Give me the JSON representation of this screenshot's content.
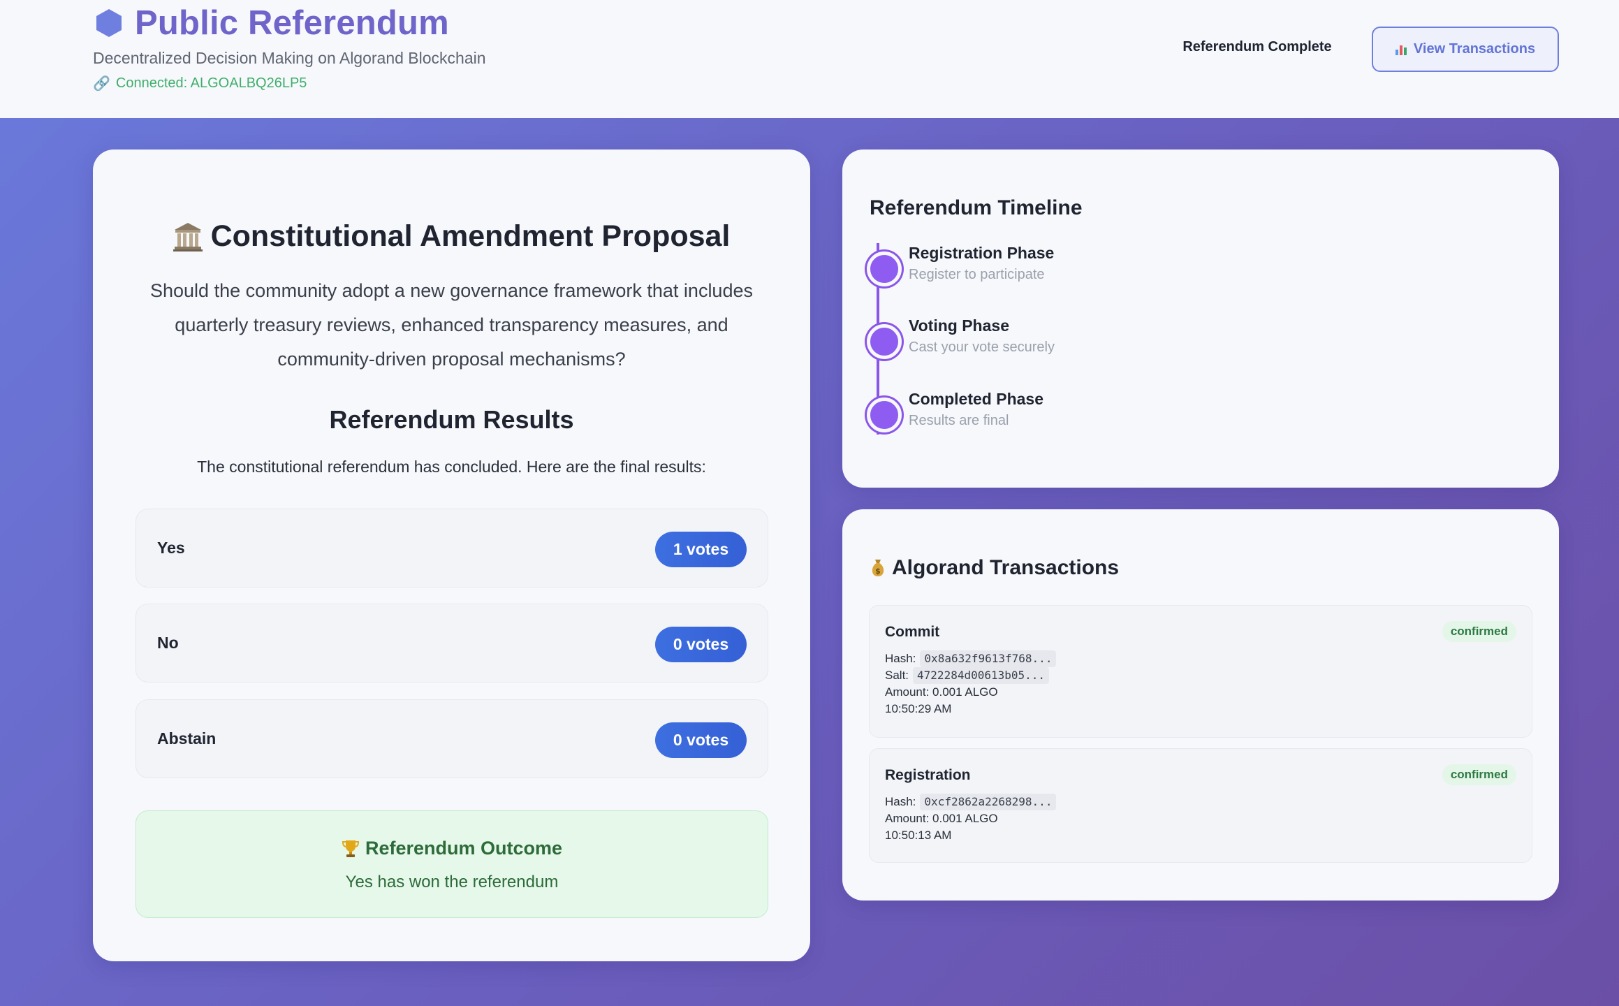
{
  "header": {
    "title": "Public Referendum",
    "subtitle": "Decentralized Decision Making on Algorand Blockchain",
    "connected_label": "Connected: ALGOALBQ26LP5",
    "status": "Referendum Complete",
    "view_transactions_label": "View Transactions",
    "icons": {
      "brand": "hexagon-icon",
      "connection": "link-icon",
      "button": "bar-chart-icon"
    },
    "colors": {
      "brand": "#6f64c9",
      "connected": "#3fae6a",
      "button_border": "#6f7fdc"
    }
  },
  "proposal": {
    "title": "Constitutional Amendment Proposal",
    "icon": "classical-building-icon",
    "description": "Should the community adopt a new governance framework that includes quarterly treasury reviews, enhanced transparency measures, and community-driven proposal mechanisms?"
  },
  "results": {
    "title": "Referendum Results",
    "description": "The constitutional referendum has concluded. Here are the final results:",
    "options": [
      {
        "label": "Yes",
        "votes_label": "1 votes"
      },
      {
        "label": "No",
        "votes_label": "0 votes"
      },
      {
        "label": "Abstain",
        "votes_label": "0 votes"
      }
    ],
    "outcome": {
      "title": "Referendum Outcome",
      "icon": "trophy-icon",
      "text": "Yes has won the referendum"
    },
    "colors": {
      "vote_pill": "#3d6fe0",
      "outcome_text": "#2d6b3a"
    }
  },
  "timeline": {
    "title": "Referendum Timeline",
    "steps": [
      {
        "name": "Registration Phase",
        "description": "Register to participate"
      },
      {
        "name": "Voting Phase",
        "description": "Cast your vote securely"
      },
      {
        "name": "Completed Phase",
        "description": "Results are final"
      }
    ],
    "colors": {
      "accent": "#8a56e8"
    }
  },
  "transactions": {
    "title": "Algorand Transactions",
    "icon": "money-bag-icon",
    "items": [
      {
        "type": "Commit",
        "status": "confirmed",
        "hash_label": "Hash:",
        "hash": "0x8a632f9613f768...",
        "salt_label": "Salt:",
        "salt": "4722284d00613b05...",
        "amount": "Amount: 0.001 ALGO",
        "time": "10:50:29 AM"
      },
      {
        "type": "Registration",
        "status": "confirmed",
        "hash_label": "Hash:",
        "hash": "0xcf2862a2268298...",
        "amount": "Amount: 0.001 ALGO",
        "time": "10:50:13 AM"
      }
    ],
    "colors": {
      "status_bg": "#e4f6e8",
      "status_text": "#2d7a43"
    }
  }
}
